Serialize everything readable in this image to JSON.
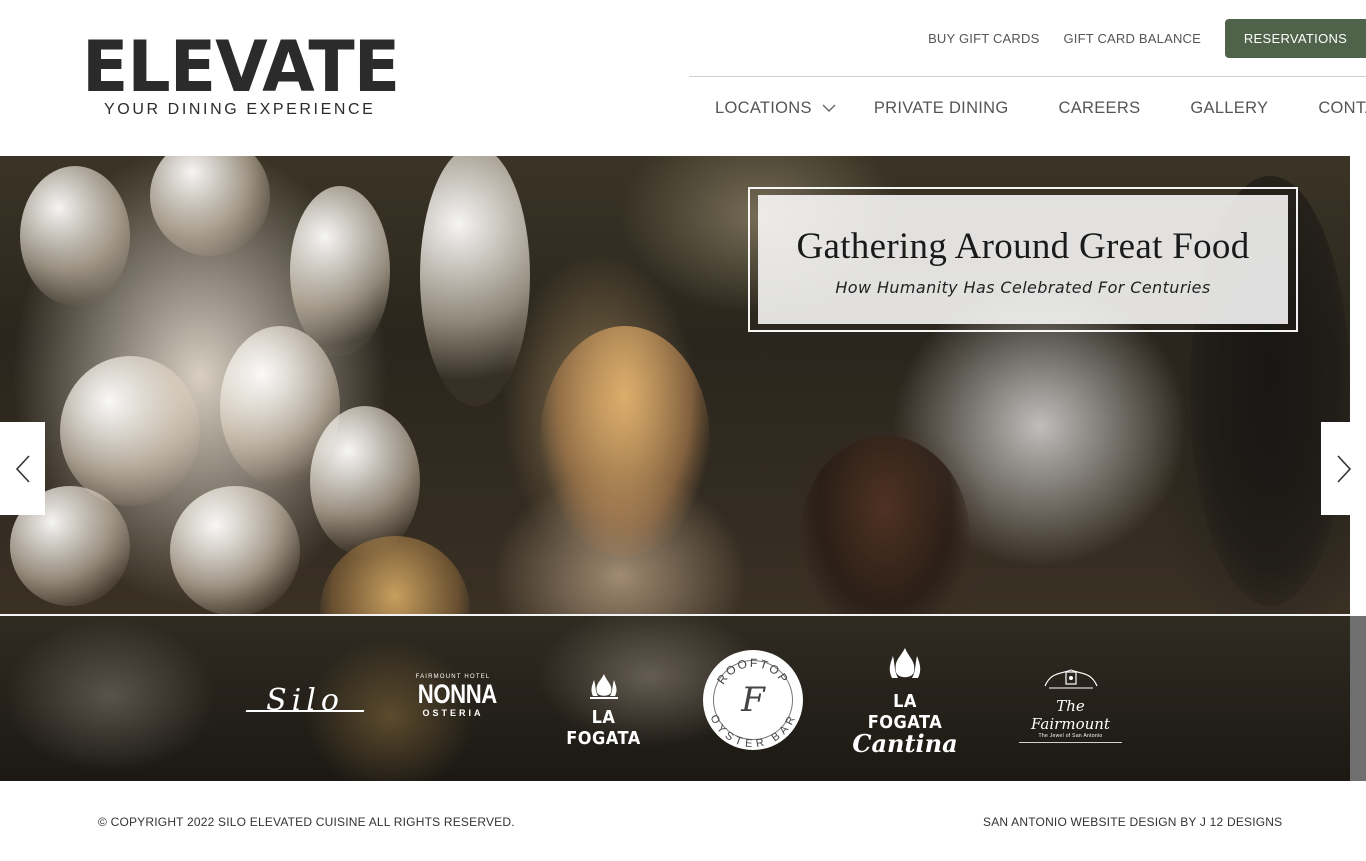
{
  "brand": {
    "logo_main": "ELEVATE",
    "logo_sub": "YOUR DINING EXPERIENCE",
    "accent_color": "#4e6349"
  },
  "top_links": {
    "buy_gift_cards": "BUY GIFT CARDS",
    "gift_card_balance": "GIFT CARD BALANCE",
    "reservations": "RESERVATIONS"
  },
  "nav": {
    "items": [
      {
        "label": "LOCATIONS",
        "icon": "chevron-down-icon"
      },
      {
        "label": "PRIVATE DINING"
      },
      {
        "label": "CAREERS"
      },
      {
        "label": "GALLERY"
      },
      {
        "label": "CONTACT"
      }
    ]
  },
  "hero": {
    "title": "Gathering Around Great Food",
    "subtitle": "How Humanity Has Celebrated For Centuries",
    "prev_icon": "chevron-left-icon",
    "next_icon": "chevron-right-icon"
  },
  "brands": {
    "silo": "Silo",
    "nonna_top": "FAIRMOUNT HOTEL",
    "nonna": "NONNA",
    "nonna_sub": "OSTERIA",
    "la_fogata": "LA FOGATA",
    "rooftop_top": "ROOFTOP",
    "rooftop_mono": "F",
    "rooftop_bottom": "OYSTER BAR",
    "cantina_top": "LA FOGATA",
    "cantina_script": "Cantina",
    "fairmount": "The Fairmount",
    "fairmount_tag": "The Jewel of San Antonio"
  },
  "footer": {
    "copyright": "© COPYRIGHT 2022 SILO ELEVATED CUISINE ALL RIGHTS RESERVED.",
    "credit": "SAN ANTONIO WEBSITE DESIGN BY J 12 DESIGNS"
  }
}
